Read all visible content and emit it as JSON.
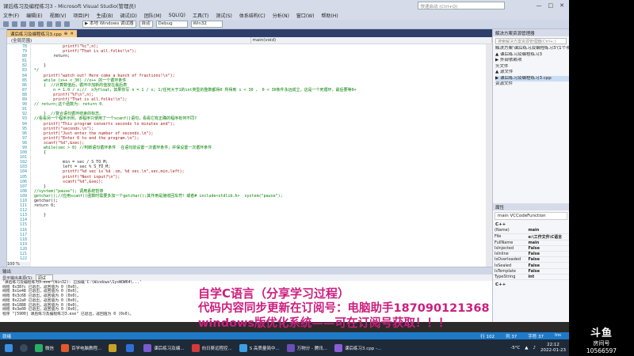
{
  "window": {
    "title": "课后练习及编程练习3 - Microsoft Visual Studio(管理员)",
    "quick_launch_placeholder": "快速启动 (Ctrl+Q)",
    "controls": [
      "—",
      "□",
      "✕"
    ]
  },
  "menu": [
    "文件(F)",
    "编辑(E)",
    "视图(V)",
    "项目(P)",
    "生成(B)",
    "调试(D)",
    "团队(M)",
    "SQL(Q)",
    "工具(T)",
    "测试(S)",
    "体系结构(C)",
    "分析(N)",
    "窗口(W)",
    "帮助(H)"
  ],
  "toolbar": {
    "debugger_label": "▶ 本地 Windows 调试器",
    "auto_dd": "自动",
    "config_dd": "Debug",
    "platform_dd": "Win32"
  },
  "doc_tab": {
    "label": "课后练习及编程练习3.cpp",
    "close": "✕",
    "pin": "⊕"
  },
  "navbar": {
    "scope": "(全局范围)",
    "function": "main(void)"
  },
  "editor": {
    "zoom": "100 %",
    "line_numbers": [
      "78",
      "79",
      "80",
      "81",
      "82",
      "83",
      "84",
      "85",
      "86",
      "87",
      "88",
      "89",
      "90",
      "91",
      "92",
      "93",
      "94",
      "95",
      "96",
      "97",
      "98",
      "99",
      "100",
      "101",
      "102",
      "103",
      "104",
      "105",
      "106",
      "107",
      "108",
      "109",
      "110",
      "111",
      "112",
      "113",
      "114",
      "115",
      "116",
      "117",
      "118",
      "119",
      "120",
      "121",
      "122"
    ],
    "lines": [
      {
        "t": "            printf(\"%c\",n);",
        "c": "str"
      },
      {
        "t": "            printf(\"That is all.folks!\\n\");",
        "c": "str"
      },
      {
        "t": "        return;",
        "c": ""
      },
      {
        "t": "",
        "c": ""
      },
      {
        "t": "    }",
        "c": ""
      },
      {
        "t": "*/",
        "c": "cmt"
      },
      {
        "t": "    printf(\"watch out! Here come a bunch of fractions!\\n\");",
        "c": "str"
      },
      {
        "t": "    while (x++ < 30) //x++ 的一个循环条件",
        "c": "cmt"
      },
      {
        "t": "    {  //计算数值后，循环中加新的值放在最后表",
        "c": "cmt"
      },
      {
        "t": "        n = 1.0 / x;//  n为float，如果你写 n = 1 / x; 1/任何大于1的int类型的整数都得0 所得到 i < 30 ， 0 < 30条件永远成立，这是一个死循环，最后要等0+",
        "c": "cmt"
      },
      {
        "t": "        printf(\"%f\\n\",n);",
        "c": "str"
      },
      {
        "t": "        printf(\"That is all.folks!\\n\");",
        "c": "str"
      },
      {
        "t": "// return;这个函数为: return 0.",
        "c": "cmt"
      },
      {
        "t": "",
        "c": ""
      },
      {
        "t": "    }  //复合语句循环结束的标志。",
        "c": "cmt"
      },
      {
        "t": "//看看另一个程序示例，该程序只使用了一个scanf()语句，看看它有正确的程序有何不同?",
        "c": "cmt"
      },
      {
        "t": "    printf(\"This program converts seconds to minutes and\");",
        "c": "str"
      },
      {
        "t": "    printf(\"seconds.\\n\");",
        "c": "str"
      },
      {
        "t": "    printf(\"Just enter the number of seconds.\\n\");",
        "c": "str"
      },
      {
        "t": "    printf(\"Enter 0 to end the program.\\n\");",
        "c": "str"
      },
      {
        "t": "    scanf(\"%d\",&sec);",
        "c": "str"
      },
      {
        "t": "    while(sec > 0) //判断语句循环条件  在语句前设置一次循环条件，并保设置一次循环条件",
        "c": "cmt"
      },
      {
        "t": "    {",
        "c": ""
      },
      {
        "t": "",
        "c": ""
      },
      {
        "t": "            min = sec / S_TO_M;",
        "c": ""
      },
      {
        "t": "            left = sec % S_TO_M;",
        "c": ""
      },
      {
        "t": "            printf(\"%d sec is %d .cm, %d sec.\\n\",sec,min,left);",
        "c": "str"
      },
      {
        "t": "            printf(\"Next input?\\n\");",
        "c": "str"
      },
      {
        "t": "            scanf(\"%d\",&sec);",
        "c": "str"
      },
      {
        "t": "    }",
        "c": ""
      },
      {
        "t": "//system(\"pause\"); 调用系统暂停",
        "c": "cmt"
      },
      {
        "t": "getchar();//应用scanf()函数时需要多加一个getchar();其作用是接收回车符！或者# include<stdlib.h>  system(\"pause\");",
        "c": "cmt"
      },
      {
        "t": "getchar();",
        "c": ""
      },
      {
        "t": "return 0;",
        "c": ""
      },
      {
        "t": "",
        "c": ""
      },
      {
        "t": "    }",
        "c": ""
      }
    ]
  },
  "solution_explorer": {
    "title": "解决方案资源管理器",
    "search_placeholder": "搜索解决方案资源管理器(Ctrl+;)",
    "items": [
      "解决方案'课后练习及编程练习3'(1个项目)",
      "  ▲ 课后练习及编程练习3",
      "    ▶ 外部依赖项",
      "      头文件",
      "    ▲ 源文件",
      "      ▶ 课后练习及编程练习3.cpp",
      "      资源文件"
    ]
  },
  "properties": {
    "title": "属性",
    "object": "main  VCCodeFunction",
    "category": "C++",
    "rows": [
      [
        "(Name)",
        "main"
      ],
      [
        "File",
        "e:\\工作文件\\C语言"
      ],
      [
        "FullName",
        "main"
      ],
      [
        "IsInjected",
        "False"
      ],
      [
        "IsInline",
        "False"
      ],
      [
        "IsOverloaded",
        "False"
      ],
      [
        "IsSealed",
        "False"
      ],
      [
        "IsTemplate",
        "False"
      ],
      [
        "TypeString",
        "int"
      ]
    ],
    "footer": "C++"
  },
  "output": {
    "title": "输出",
    "source_label": "显示输出来源(S):",
    "source_value": "调试",
    "lines": [
      "'课后练习及编程练习3.exe'(Win32): 已加载'C:\\Windows\\SysWOW64\\...'",
      "线程 0x38fc 已退出，返回值为 0 (0x0)。",
      "线程 0x1e48 已退出，返回值为 0 (0x0)。",
      "线程 0x3c68 已退出，返回值为 0 (0x0)。",
      "线程 0x22a0 已退出，返回值为 0 (0x0)。",
      "线程 0x1888 已退出，返回值为 0 (0x0)。",
      "线程 0x3e00 已退出，返回值为 0 (0x0)。",
      "程序 \"[5900] 课后练习及编程练习3.exe\" 已退出，返回值为 0 (0x0)。"
    ]
  },
  "overlay": {
    "line1": "自学C语言（分享学习过程）",
    "line2": "代码内容同步更新在订阅号：电脑助手187090121368",
    "line3": "windows版优化系统——可在订阅号获取！！！"
  },
  "status": {
    "left": "就绪",
    "ln": "行 102",
    "col": "列 37",
    "ch": "字符 37",
    "ins": "Ins"
  },
  "taskbar": {
    "items": [
      "微信",
      "百学电脑教程...",
      "",
      "",
      "课后练习及编...",
      "向日葵远程控...",
      "S 高质量简中...",
      "万物分 - 腾讯...",
      "课后练习3.cpp -..."
    ],
    "weather": "-5°C",
    "time": "22:12",
    "date": "2022-01-23"
  },
  "watermark": {
    "logo": "斗鱼",
    "sub": "房间号",
    "id": "10566597"
  },
  "colors": {
    "accent": "#1e7ac8",
    "overlay_text": "#cc1e7e",
    "tab_active": "#f5cc84"
  }
}
